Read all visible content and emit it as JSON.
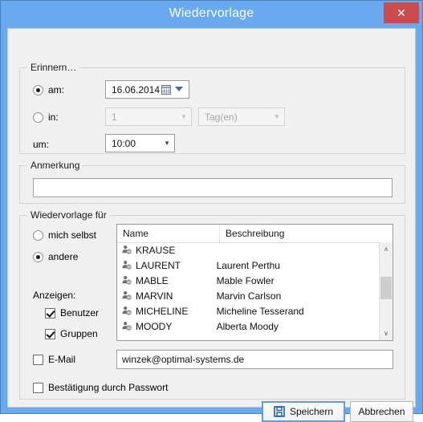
{
  "window": {
    "title": "Wiedervorlage",
    "close_label": "✕",
    "accent_color": "#69a9ef",
    "close_color": "#cc4b4b"
  },
  "remind_group": {
    "title": "Erinnern…",
    "option_on_date": {
      "label": "am:",
      "selected": true,
      "date_value": "16.06.2014",
      "calendar_icon": "calendar-icon",
      "dropdown_icon": "chevron-down-icon"
    },
    "option_in": {
      "label": "in:",
      "selected": false,
      "amount_value": "1",
      "unit_value": "Tag(en)",
      "disabled": true
    },
    "time_row": {
      "label": "um:",
      "value": "10:00"
    }
  },
  "note_group": {
    "title": "Anmerkung",
    "value": "",
    "placeholder": ""
  },
  "target_group": {
    "title": "Wiedervorlage für",
    "option_self": {
      "label": "mich selbst",
      "selected": false
    },
    "option_other": {
      "label": "andere",
      "selected": true
    },
    "show_label": "Anzeigen:",
    "show_users": {
      "label": "Benutzer",
      "checked": true
    },
    "show_groups": {
      "label": "Gruppen",
      "checked": true
    },
    "list": {
      "columns": [
        "Name",
        "Beschreibung"
      ],
      "rows": [
        {
          "icon": "user-icon",
          "name": "KRAUSE",
          "description": ""
        },
        {
          "icon": "user-icon",
          "name": "LAURENT",
          "description": "Laurent Perthu"
        },
        {
          "icon": "user-icon",
          "name": "MABLE",
          "description": "Mable Fowler"
        },
        {
          "icon": "user-icon",
          "name": "MARVIN",
          "description": "Marvin Carlson"
        },
        {
          "icon": "user-icon",
          "name": "MICHELINE",
          "description": "Micheline Tesserand"
        },
        {
          "icon": "user-icon",
          "name": "MOODY",
          "description": "Alberta Moody"
        }
      ],
      "scroll_up_icon": "∧",
      "scroll_down_icon": "∨"
    },
    "email": {
      "label": "E-Mail",
      "checked": false,
      "value": "winzek@optimal-systems.de"
    },
    "password_confirm": {
      "label": "Bestätigung durch Passwort",
      "checked": false
    }
  },
  "footer": {
    "save_label": "Speichern",
    "save_icon": "save-floppy-icon",
    "cancel_label": "Abbrechen"
  }
}
